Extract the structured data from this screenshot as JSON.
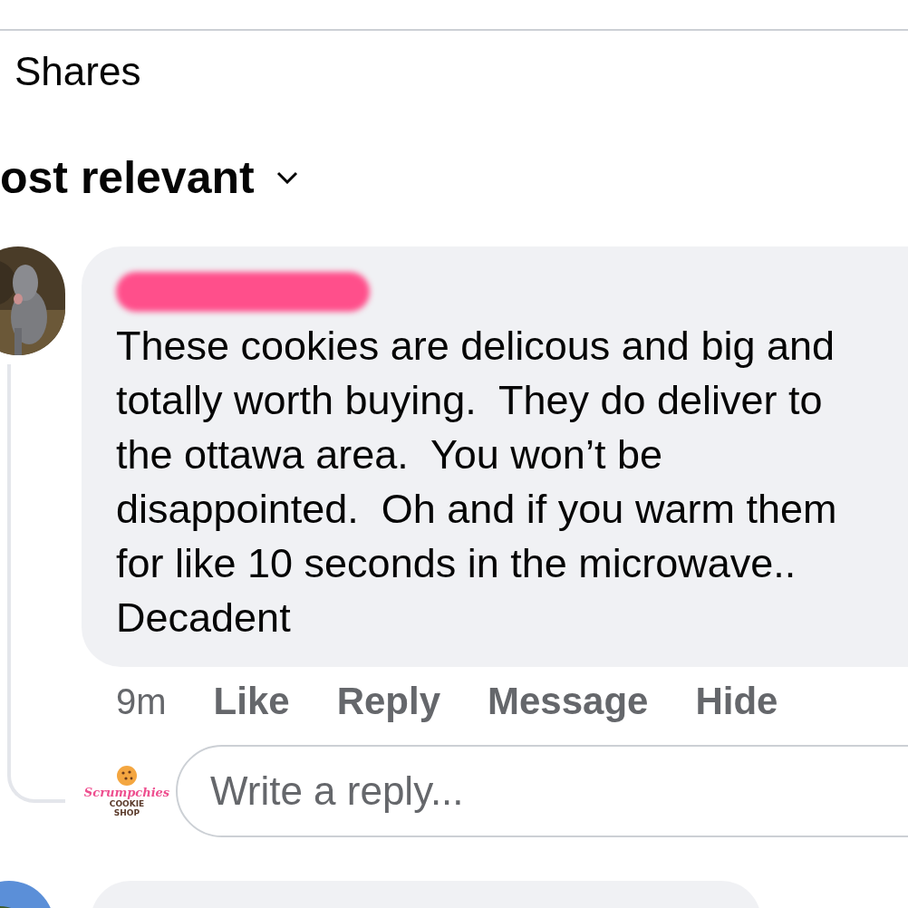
{
  "shares": "Shares",
  "sort": {
    "label": "ost relevant"
  },
  "comments": [
    {
      "author_redacted": true,
      "text": "These cookies are delicous and big and totally worth buying.  They do deliver to the ottawa area.  You won’t be disappointed.  Oh and if you warm them for like 10 seconds in the microwave.. Decadent",
      "time": "9m",
      "actions": [
        "Like",
        "Reply",
        "Message",
        "Hide"
      ]
    }
  ],
  "reply_box": {
    "logo": {
      "name": "Scrumpchies",
      "line_1": "COOKIE",
      "line_2": "SHOP"
    },
    "placeholder": "Write a reply..."
  }
}
